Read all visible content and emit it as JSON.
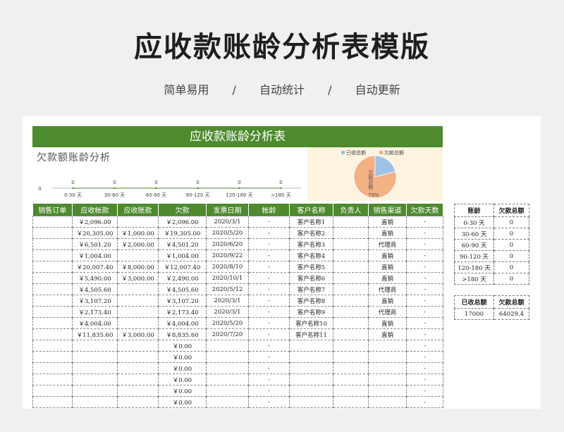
{
  "page": {
    "title": "应收款账龄分析表模版",
    "tags": [
      "简单易用",
      "自动统计",
      "自动更新"
    ],
    "separator": "/"
  },
  "sheet": {
    "banner": "应收款账龄分析表",
    "accent": "#4e8a2e"
  },
  "chart_data": [
    {
      "type": "line",
      "title": "欠款额账龄分析",
      "categories": [
        "0-30 天",
        "30-60 天",
        "60-90 天",
        "90-120 天",
        "120-180 天",
        ">180 天"
      ],
      "values": [
        0,
        0,
        0,
        0,
        0,
        0
      ],
      "y_tick": "0",
      "data_labels": [
        "0",
        "0",
        "0",
        "0",
        "0",
        "0"
      ]
    },
    {
      "type": "pie",
      "legend": [
        "已收总额",
        "欠款总额"
      ],
      "legend_position": "top",
      "values": [
        17000,
        64029.4
      ],
      "colors": [
        "#9cc3e6",
        "#f4b183"
      ],
      "slice_label": "欠款总额",
      "percent_label": "79%"
    }
  ],
  "table": {
    "headers": [
      "销售订单",
      "应收帐款",
      "应收账款",
      "欠款",
      "发票日期",
      "帐龄",
      "客户名称",
      "负责人",
      "销售渠道",
      "欠款天数"
    ],
    "rows": [
      [
        "",
        "￥2,096.00",
        "",
        "￥2,096.00",
        "2020/3/1",
        "-",
        "客户名称1",
        "",
        "直销",
        "-"
      ],
      [
        "",
        "￥20,305.00",
        "￥1,000.00",
        "￥19,305.00",
        "2020/5/20",
        "-",
        "客户名称2",
        "",
        "直销",
        "-"
      ],
      [
        "",
        "￥6,501.20",
        "￥2,000.00",
        "￥4,501.20",
        "2020/6/20",
        "-",
        "客户名称3",
        "",
        "代理商",
        "-"
      ],
      [
        "",
        "￥1,004.00",
        "",
        "￥1,004.00",
        "2020/9/22",
        "-",
        "客户名称4",
        "",
        "直销",
        "-"
      ],
      [
        "",
        "￥20,007.40",
        "￥8,000.00",
        "￥12,007.40",
        "2020/8/10",
        "-",
        "客户名称5",
        "",
        "直销",
        "-"
      ],
      [
        "",
        "￥5,490.00",
        "￥3,000.00",
        "￥2,490.00",
        "2020/10/1",
        "-",
        "客户名称6",
        "",
        "直销",
        "-"
      ],
      [
        "",
        "￥4,505.60",
        "",
        "￥4,505.60",
        "2020/5/12",
        "-",
        "客户名称7",
        "",
        "代理商",
        "-"
      ],
      [
        "",
        "￥3,107.20",
        "",
        "￥3,107.20",
        "2020/3/1",
        "-",
        "客户名称8",
        "",
        "直销",
        "-"
      ],
      [
        "",
        "￥2,173.40",
        "",
        "￥2,173.40",
        "2020/3/1",
        "-",
        "客户名称9",
        "",
        "代理商",
        "-"
      ],
      [
        "",
        "￥4,004.00",
        "",
        "￥4,004.00",
        "2020/5/20",
        "-",
        "客户名称10",
        "",
        "直销",
        "-"
      ],
      [
        "",
        "￥11,835.60",
        "￥3,000.00",
        "￥8,835.60",
        "2020/7/20",
        "-",
        "客户名称11",
        "",
        "直销",
        "-"
      ],
      [
        "",
        "",
        "",
        "￥0.00",
        "",
        "-",
        "",
        "",
        "",
        "-"
      ],
      [
        "",
        "",
        "",
        "￥0.00",
        "",
        "-",
        "",
        "",
        "",
        "-"
      ],
      [
        "",
        "",
        "",
        "￥0.00",
        "",
        "-",
        "",
        "",
        "",
        "-"
      ],
      [
        "",
        "",
        "",
        "￥0.00",
        "",
        "-",
        "",
        "",
        "",
        "-"
      ],
      [
        "",
        "",
        "",
        "￥0.00",
        "",
        "-",
        "",
        "",
        "",
        "-"
      ],
      [
        "",
        "",
        "",
        "￥0.00",
        "",
        "-",
        "",
        "",
        "",
        "-"
      ]
    ]
  },
  "aging_summary": {
    "headers": [
      "账龄",
      "欠款总额"
    ],
    "rows": [
      [
        "0-30 天",
        "0"
      ],
      [
        "30-60 天",
        "0"
      ],
      [
        "60-90 天",
        "0"
      ],
      [
        "90-120 天",
        "0"
      ],
      [
        "120-180 天",
        "0"
      ],
      [
        ">180 天",
        "0"
      ]
    ]
  },
  "totals": {
    "headers": [
      "已收总额",
      "欠款总额"
    ],
    "values": [
      "17000",
      "64029.4"
    ]
  }
}
